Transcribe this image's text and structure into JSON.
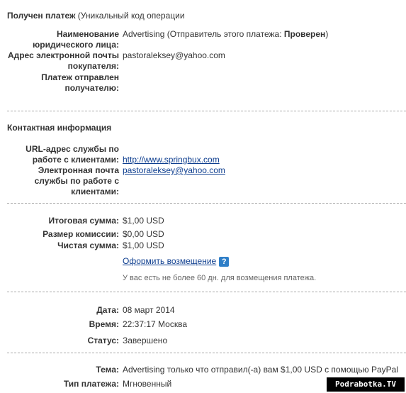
{
  "header": {
    "title_bold": "Получен платеж",
    "title_rest": " (Уникальный код операции"
  },
  "payee": {
    "legal_name_label": "Наименование юридического лица:",
    "legal_name_value": "Advertising (Отправитель этого платежа: ",
    "sender_status": "Проверен",
    "sender_status_close": ")",
    "buyer_email_label": "Адрес электронной почты покупателя:",
    "buyer_email_value": "pastoraleksey@yahoo.com",
    "sent_to_label": "Платеж отправлен получателю:"
  },
  "contact": {
    "section_title": "Контактная информация",
    "support_url_label": "URL-адрес службы по работе с клиентами:",
    "support_url_value": "http://www.springbux.com",
    "support_email_label": "Электронная почта службы по работе с клиентами:",
    "support_email_value": "pastoraleksey@yahoo.com"
  },
  "amounts": {
    "total_label": "Итоговая сумма:",
    "total_value": "$1,00 USD",
    "fee_label": "Размер комиссии:",
    "fee_value": "$0,00 USD",
    "net_label": "Чистая сумма:",
    "net_value": "$1,00 USD",
    "refund_link": "Оформить возмещение",
    "help_icon": "question-icon",
    "help_glyph": "?",
    "refund_note": "У вас есть не более 60 дн. для возмещения платежа."
  },
  "status_block": {
    "date_label": "Дата:",
    "date_value": "08 март 2014",
    "time_label": "Время:",
    "time_value": "22:37:17 Москва",
    "status_label": "Статус:",
    "status_value": "Завершено"
  },
  "details": {
    "subject_label": "Тема:",
    "subject_value": "Advertising только что отправил(-а) вам $1,00 USD с помощью PayPal",
    "payment_type_label": "Тип платежа:",
    "payment_type_value": "Мгновенный"
  },
  "watermark": "Podrabotka.TV"
}
